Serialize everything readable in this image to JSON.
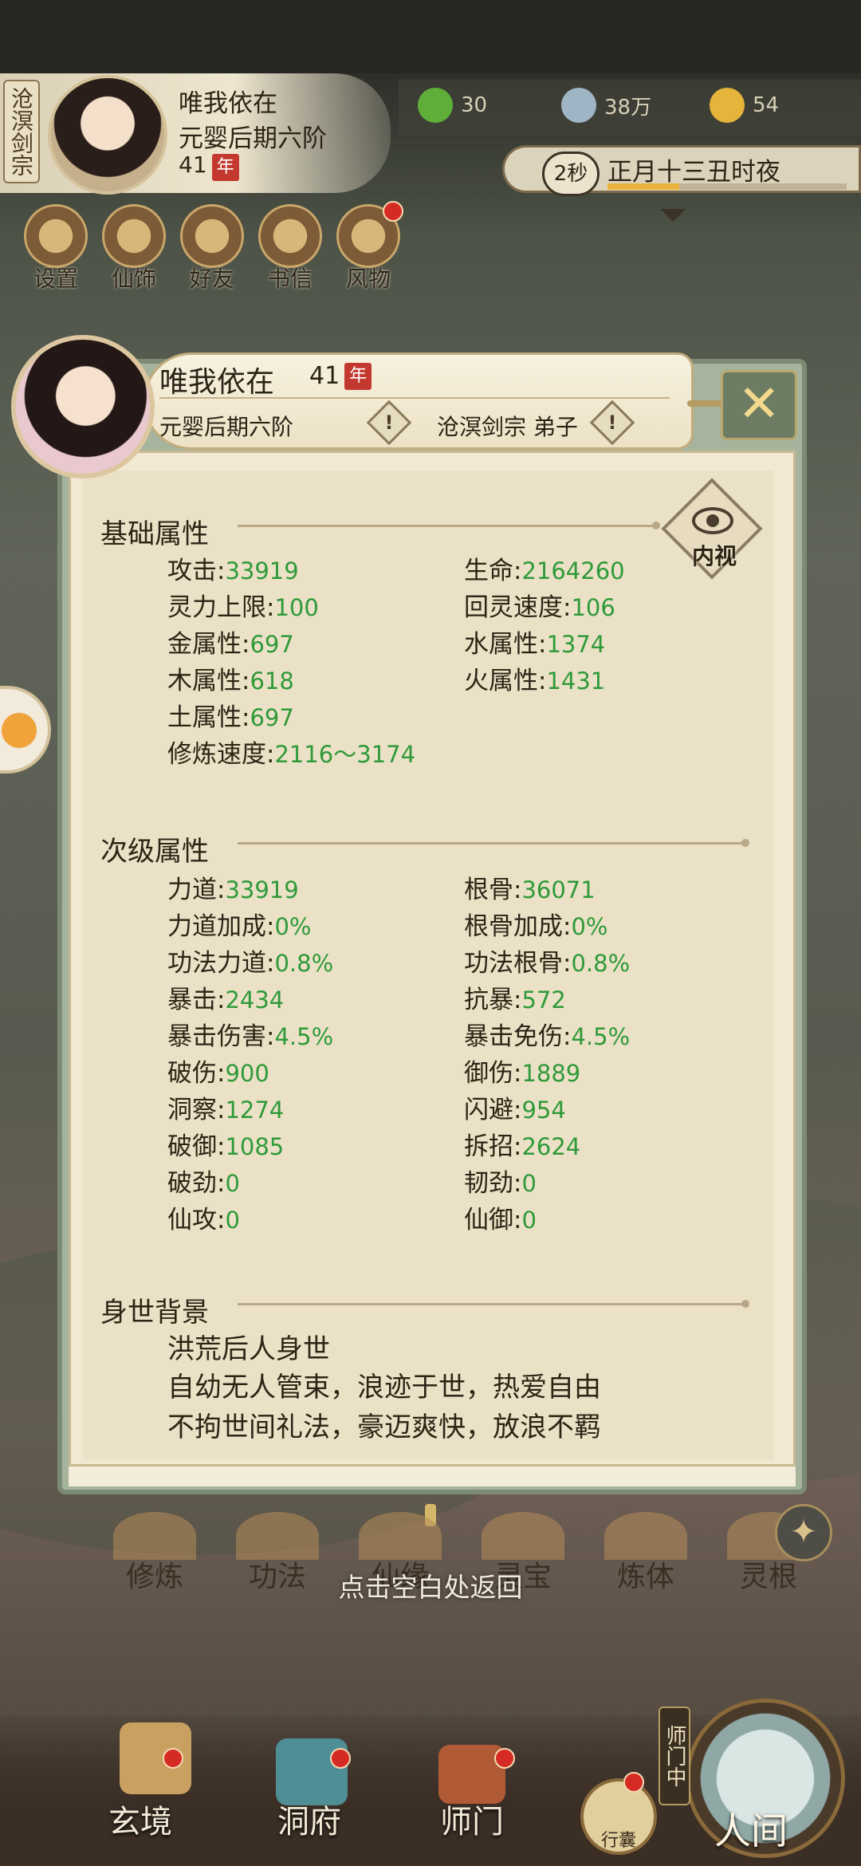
{
  "top": {
    "sect_tag": "沧溟剑宗",
    "player_name": "唯我依在",
    "realm": "元婴后期六阶",
    "age": "41",
    "age_unit": "年",
    "resources": [
      {
        "name": "leaf-icon",
        "value": "30",
        "color": "#5fae3a"
      },
      {
        "name": "coin-icon",
        "value": "38万",
        "color": "#9fb4c4"
      },
      {
        "name": "strength-icon",
        "value": "54",
        "color": "#e5b43a"
      }
    ],
    "timer_seconds": "2秒",
    "game_time": "正月十三丑时夜",
    "time_progress": 0.3
  },
  "menu": [
    {
      "label": "设置",
      "icon": "gear-icon",
      "badge": false
    },
    {
      "label": "仙饰",
      "icon": "costume-icon",
      "badge": false
    },
    {
      "label": "好友",
      "icon": "friends-icon",
      "badge": false
    },
    {
      "label": "书信",
      "icon": "letter-icon",
      "badge": false
    },
    {
      "label": "风物",
      "icon": "scenery-icon",
      "badge": true
    }
  ],
  "modal": {
    "name": "唯我依在",
    "age": "41",
    "age_unit": "年",
    "realm": "元婴后期六阶",
    "sect_role": "沧溟剑宗  弟子",
    "close_icon": "close-icon",
    "inner_sight_label": "内视",
    "basic": {
      "title": "基础属性",
      "left": [
        {
          "k": "攻击",
          "v": "33919"
        },
        {
          "k": "灵力上限",
          "v": "100"
        },
        {
          "k": "金属性",
          "v": "697"
        },
        {
          "k": "木属性",
          "v": "618"
        },
        {
          "k": "土属性",
          "v": "697"
        },
        {
          "k": "修炼速度",
          "v": "2116～3174"
        }
      ],
      "right": [
        {
          "k": "生命",
          "v": "2164260"
        },
        {
          "k": "回灵速度",
          "v": "106"
        },
        {
          "k": "水属性",
          "v": "1374"
        },
        {
          "k": "火属性",
          "v": "1431"
        }
      ]
    },
    "secondary": {
      "title": "次级属性",
      "left": [
        {
          "k": "力道",
          "v": "33919"
        },
        {
          "k": "力道加成",
          "v": "0%"
        },
        {
          "k": "功法力道",
          "v": "0.8%"
        },
        {
          "k": "暴击",
          "v": "2434"
        },
        {
          "k": "暴击伤害",
          "v": "4.5%"
        },
        {
          "k": "破伤",
          "v": "900"
        },
        {
          "k": "洞察",
          "v": "1274"
        },
        {
          "k": "破御",
          "v": "1085"
        },
        {
          "k": "破劲",
          "v": "0"
        },
        {
          "k": "仙攻",
          "v": "0"
        }
      ],
      "right": [
        {
          "k": "根骨",
          "v": "36071"
        },
        {
          "k": "根骨加成",
          "v": "0%"
        },
        {
          "k": "功法根骨",
          "v": "0.8%"
        },
        {
          "k": "抗暴",
          "v": "572"
        },
        {
          "k": "暴击免伤",
          "v": "4.5%"
        },
        {
          "k": "御伤",
          "v": "1889"
        },
        {
          "k": "闪避",
          "v": "954"
        },
        {
          "k": "拆招",
          "v": "2624"
        },
        {
          "k": "韧劲",
          "v": "0"
        },
        {
          "k": "仙御",
          "v": "0"
        }
      ]
    },
    "background": {
      "title": "身世背景",
      "lines": [
        "洪荒后人身世",
        "自幼无人管束，浪迹于世，热爱自由",
        "不拘世间礼法，豪迈爽快，放浪不羁"
      ]
    }
  },
  "skills": [
    "修炼",
    "功法",
    "仙缘",
    "灵宝",
    "炼体",
    "灵根"
  ],
  "hint": "点击空白处返回",
  "bottom_nav": {
    "items": [
      "玄境",
      "洞府",
      "师门"
    ],
    "bag": "行囊",
    "shimen_tag": "师门中",
    "world": "人间"
  }
}
